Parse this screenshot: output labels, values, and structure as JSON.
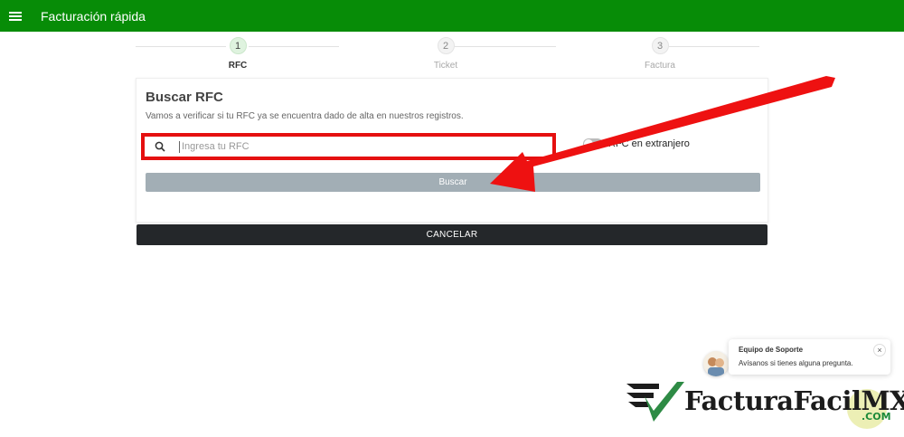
{
  "app": {
    "title": "Facturación rápida"
  },
  "stepper": {
    "steps": [
      {
        "number": "1",
        "label": "RFC",
        "active": true
      },
      {
        "number": "2",
        "label": "Ticket",
        "active": false
      },
      {
        "number": "3",
        "label": "Factura",
        "active": false
      }
    ]
  },
  "card": {
    "title": "Buscar RFC",
    "subtitle": "Vamos a verificar si tu RFC ya se encuentra dado de alta en nuestros registros.",
    "search": {
      "placeholder": "Ingresa tu RFC",
      "value": ""
    },
    "foreign_toggle": {
      "label": "RFC en extranjero",
      "checked": false
    },
    "search_button": "Buscar"
  },
  "cancel_button": "CANCELAR",
  "support": {
    "name": "Equipo de Soporte",
    "message": "Avísanos si tienes alguna pregunta.",
    "close_glyph": "×"
  },
  "logo": {
    "brand": "FacturaFacil",
    "brand_suffix": "MX",
    "domain": ".COM"
  },
  "colors": {
    "topbar": "#078c07",
    "highlight": "#e51010",
    "search_button": "#a2aeb5",
    "cancel_button": "#24272a"
  }
}
